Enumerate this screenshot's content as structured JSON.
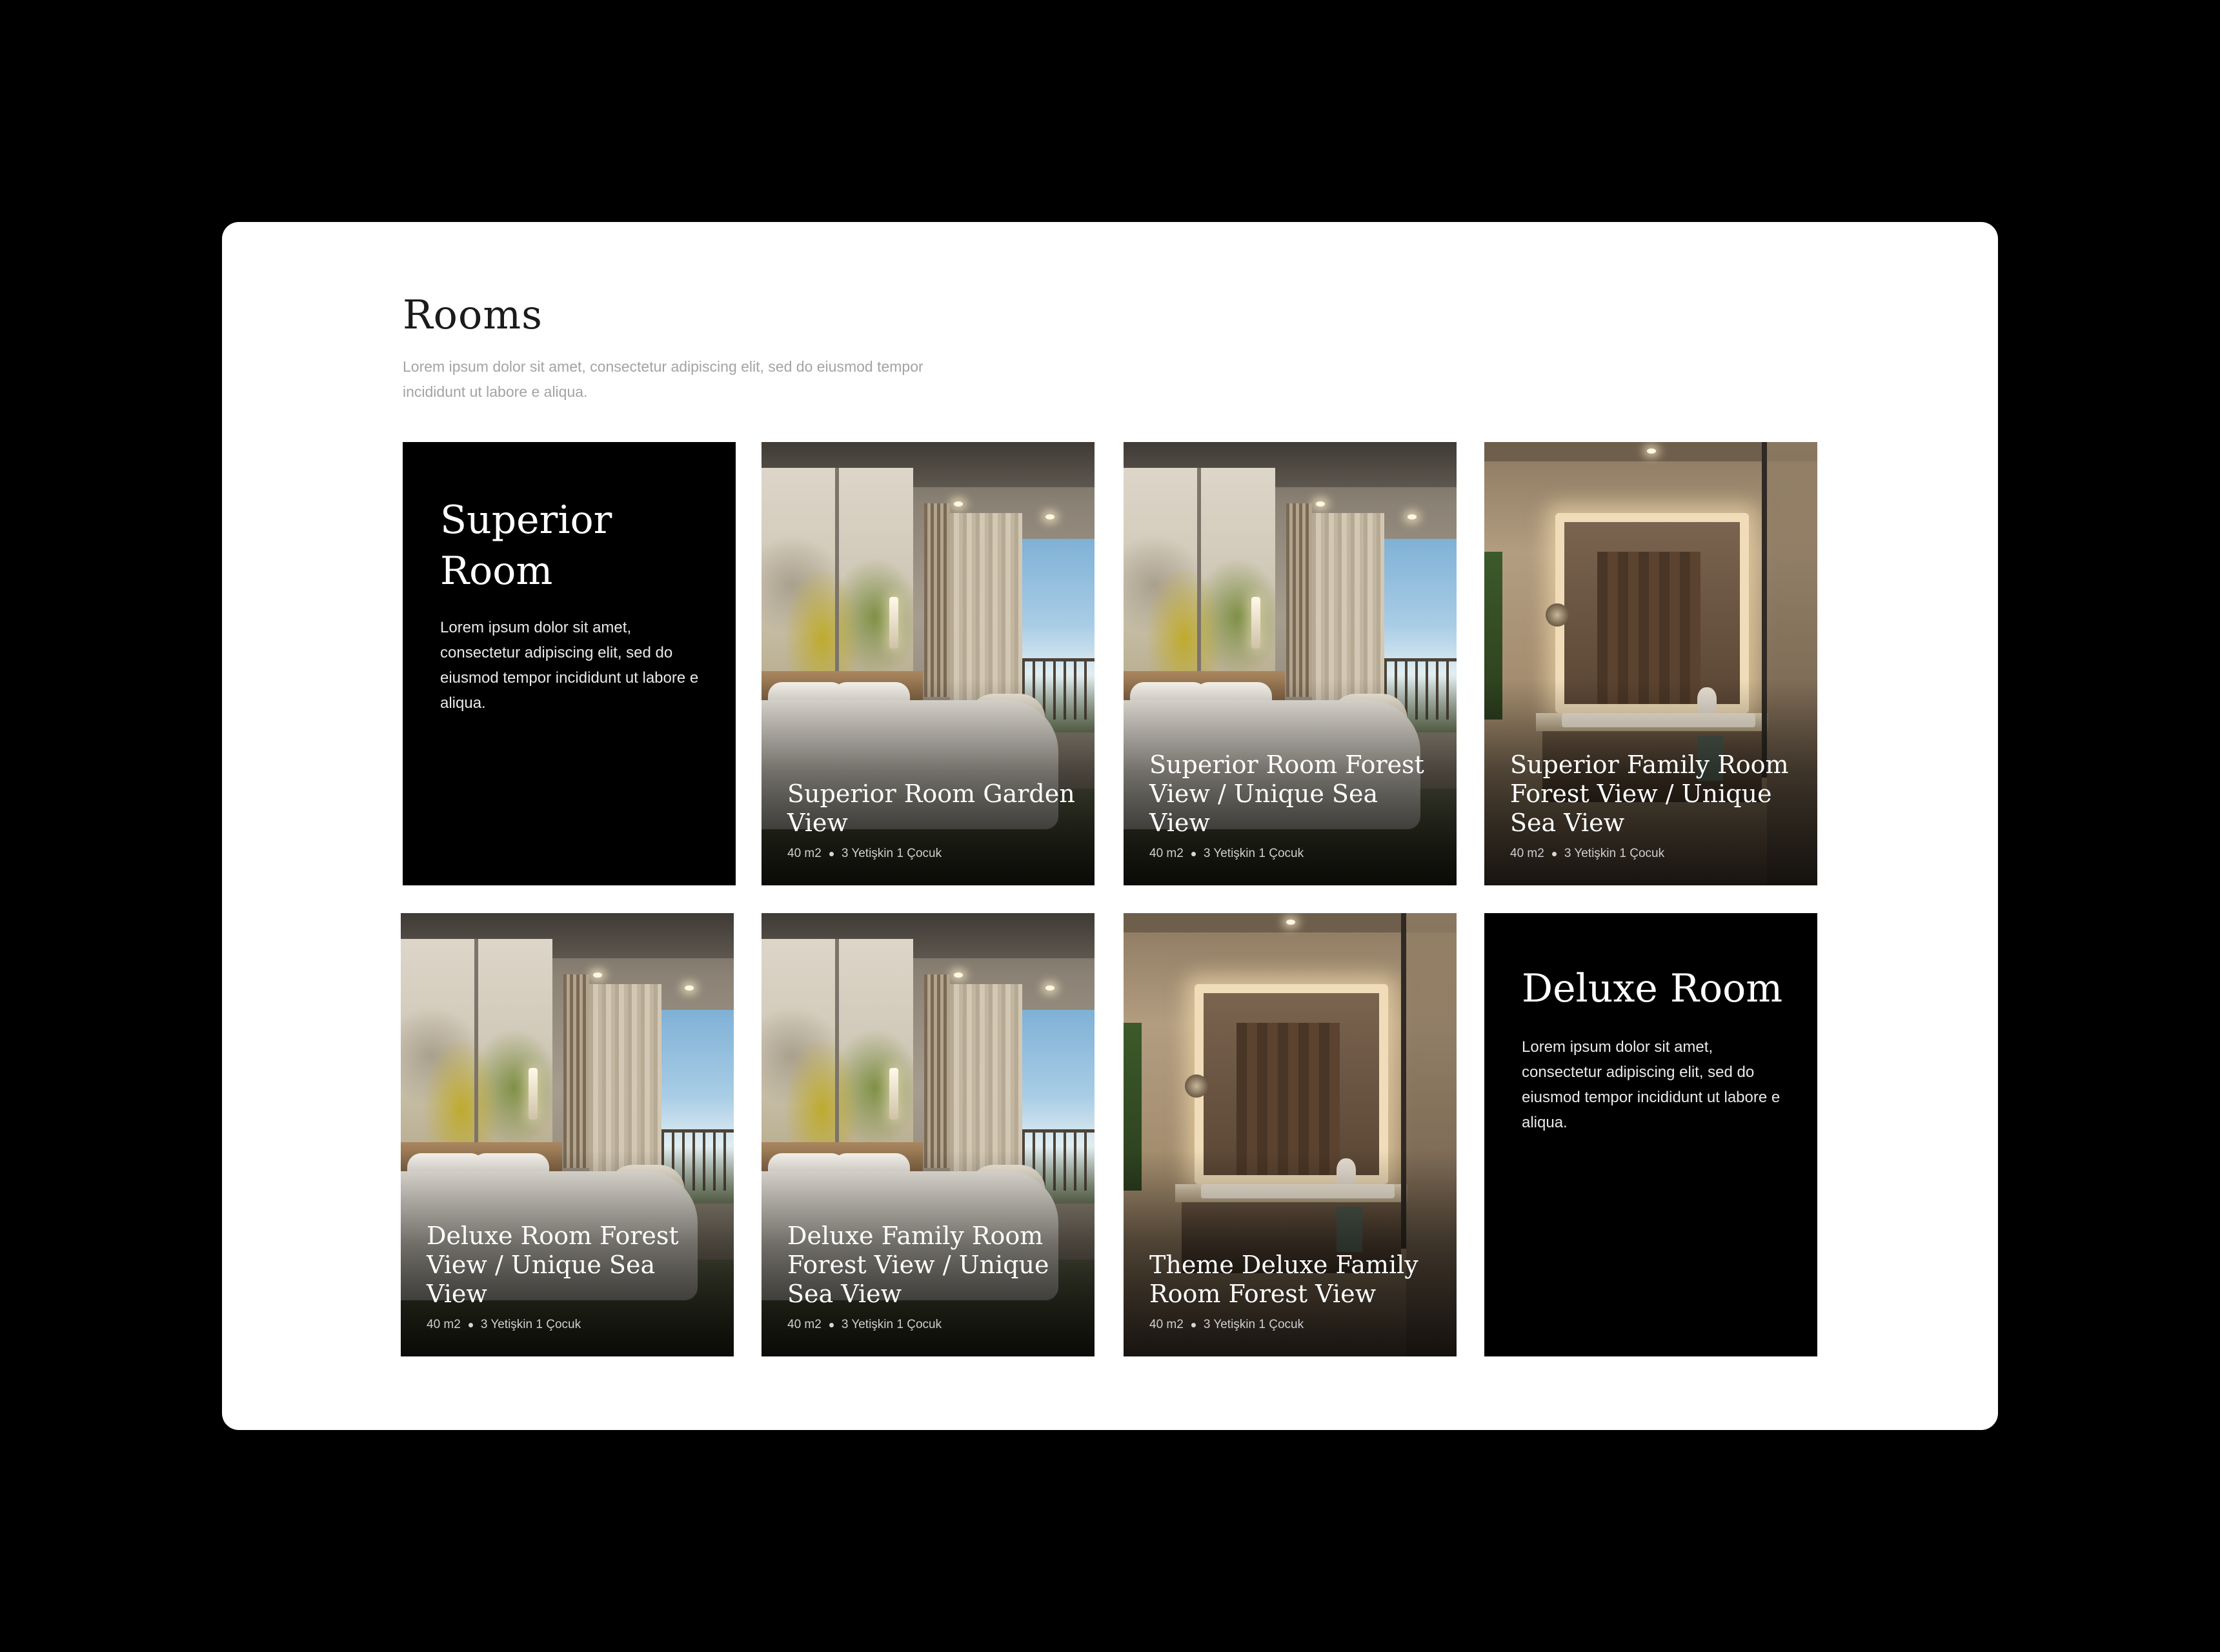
{
  "section": {
    "title": "Rooms",
    "description": "Lorem ipsum dolor sit amet, consectetur adipiscing elit, sed do eiusmod tempor incididunt ut labore e aliqua."
  },
  "info_cards": [
    {
      "title": "Superior Room",
      "description": "Lorem ipsum dolor sit amet, consectetur adipiscing elit, sed do eiusmod tempor incididunt ut labore e aliqua."
    },
    {
      "title": "Deluxe Room",
      "description": "Lorem ipsum dolor sit amet, consectetur adipiscing elit, sed do eiusmod tempor incididunt ut labore e aliqua."
    }
  ],
  "room_cards": [
    {
      "title": "Superior Room Garden View",
      "size": "40 m2",
      "capacity": "3 Yetişkin 1 Çocuk",
      "image": "bedroom-photo"
    },
    {
      "title": "Superior Room Forest View / Unique Sea View",
      "size": "40 m2",
      "capacity": "3 Yetişkin 1 Çocuk",
      "image": "bedroom-photo"
    },
    {
      "title": "Superior Family Room Forest View / Unique Sea View",
      "size": "40 m2",
      "capacity": "3 Yetişkin 1 Çocuk",
      "image": "bathroom-photo"
    },
    {
      "title": "Deluxe Room Forest View / Unique Sea View",
      "size": "40 m2",
      "capacity": "3 Yetişkin 1 Çocuk",
      "image": "bedroom-photo"
    },
    {
      "title": "Deluxe Family Room Forest View / Unique Sea View",
      "size": "40 m2",
      "capacity": "3 Yetişkin 1 Çocuk",
      "image": "bedroom-photo"
    },
    {
      "title": "Theme Deluxe Family Room Forest View",
      "size": "40 m2",
      "capacity": "3 Yetişkin 1 Çocuk",
      "image": "bathroom-photo"
    }
  ],
  "colors": {
    "page_background": "#000000",
    "panel_background": "#ffffff",
    "info_card_background": "#000000",
    "title_text": "#1b1b1b",
    "muted_text": "#a3a3a3"
  }
}
